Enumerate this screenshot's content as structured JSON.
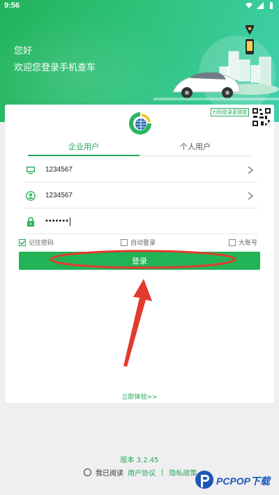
{
  "status_bar": {
    "time": "9:56"
  },
  "header": {
    "greeting": "您好",
    "welcome": "欢迎您登录手机查车"
  },
  "card": {
    "scan_label": "扫码登录更便捷",
    "tabs": [
      {
        "label": "企业用户",
        "active": true
      },
      {
        "label": "个人用户",
        "active": false
      }
    ],
    "fields": {
      "account": {
        "value": "1234567",
        "icon": "monitor-icon"
      },
      "username": {
        "value": "1234567",
        "icon": "user-icon"
      },
      "password": {
        "value": "•••••••",
        "icon": "lock-icon"
      }
    },
    "options": {
      "remember": "记住密码",
      "auto_login": "自动登录",
      "big_account": "大账号"
    },
    "login_label": "登录",
    "try_link": "立即体验>>"
  },
  "footer": {
    "version": "版本  3.2.45",
    "read_label": "我已阅读",
    "user_agreement": "用户协议",
    "separator": "|",
    "privacy_policy": "隐私政策"
  },
  "watermark": {
    "text": "PCPOP下载"
  },
  "colors": {
    "brand_green": "#22b356",
    "header_teal": "#3fd0ad",
    "annotation_red": "#e23b2e",
    "watermark_blue": "#1c57b8"
  }
}
